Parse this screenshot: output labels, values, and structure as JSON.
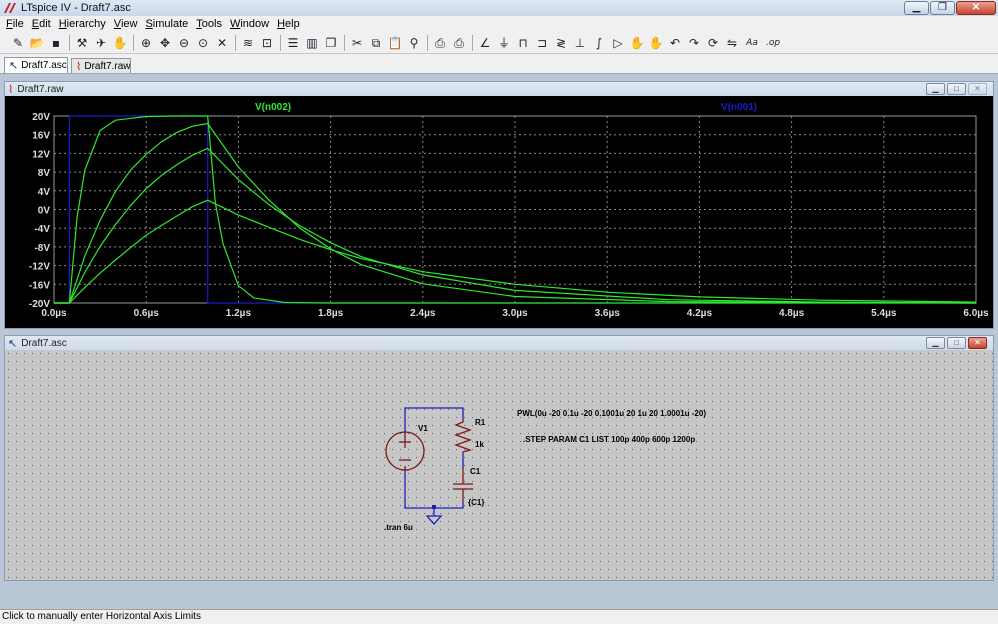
{
  "window": {
    "title": "LTspice IV - Draft7.asc"
  },
  "menu": {
    "items": [
      {
        "key": "F",
        "rest": "ile"
      },
      {
        "key": "E",
        "rest": "dit"
      },
      {
        "key": "H",
        "rest": "ierarchy"
      },
      {
        "key": "V",
        "rest": "iew"
      },
      {
        "key": "S",
        "rest": "imulate"
      },
      {
        "key": "T",
        "rest": "ools"
      },
      {
        "key": "W",
        "rest": "indow"
      },
      {
        "key": "H",
        "rest": "elp"
      }
    ]
  },
  "toolbar": {
    "icons": [
      "new-schematic",
      "open-folder",
      "save",
      "|",
      "control-panel",
      "run",
      "halt",
      "|",
      "zoom-in",
      "pan",
      "zoom-out",
      "zoom-fit",
      "zoom-cancel",
      "|",
      "autorange",
      "measure",
      "|",
      "tile-horizontal",
      "tile-vertical",
      "cascade",
      "|",
      "cut",
      "copy",
      "paste",
      "find",
      "|",
      "print-preview",
      "print",
      "|",
      "wire",
      "ground",
      "label-net",
      "component",
      "resistor",
      "capacitor",
      "inductor",
      "diode",
      "move",
      "drag",
      "undo",
      "redo",
      "rotate",
      "mirror",
      "text",
      "spice-directive"
    ]
  },
  "tabs": [
    {
      "label": "Draft7.asc",
      "icon": "schematic-icon"
    },
    {
      "label": "Draft7.raw",
      "icon": "waveform-icon"
    }
  ],
  "waveform_window": {
    "title": "Draft7.raw",
    "trace_labels": [
      "V(n002)",
      "V(n001)"
    ],
    "trace_colors": {
      "V(n002)": "#2ee82e",
      "V(n001)": "#1a1acc"
    },
    "background": "#000000",
    "grid_color": "#8a8a8a"
  },
  "schematic_window": {
    "title": "Draft7.asc",
    "components": {
      "v1": {
        "ref": "V1"
      },
      "r1": {
        "ref": "R1",
        "value": "1k"
      },
      "c1": {
        "ref": "C1",
        "value": "{C1}"
      }
    },
    "directives": {
      "pwl": "PWL(0u -20 0.1u -20 0.1001u 20 1u 20 1.0001u -20)",
      "step": ".STEP PARAM C1 LIST 100p  400p 600p 1200p",
      "tran": ".tran 6u"
    },
    "wire_color": "#1d1dbb",
    "component_color": "#7a1a1a",
    "dot_color": "#5a5a5a"
  },
  "chart_data": {
    "type": "line",
    "xlabel": "",
    "ylabel": "",
    "xlim": [
      0,
      6.0
    ],
    "ylim": [
      -20,
      20
    ],
    "x_unit": "µs",
    "y_unit": "V",
    "xticks": [
      "0.0µs",
      "0.6µs",
      "1.2µs",
      "1.8µs",
      "2.4µs",
      "3.0µs",
      "3.6µs",
      "4.2µs",
      "4.8µs",
      "5.4µs",
      "6.0µs"
    ],
    "yticks": [
      "20V",
      "16V",
      "12V",
      "8V",
      "4V",
      "0V",
      "-4V",
      "-8V",
      "-12V",
      "-16V",
      "-20V"
    ],
    "grid": true,
    "series": [
      {
        "name": "V(n001)",
        "color": "#1a1acc",
        "x": [
          0.0,
          0.1,
          0.1001,
          1.0,
          1.0001,
          6.0
        ],
        "y": [
          -20,
          -20,
          20,
          20,
          -20,
          -20
        ]
      },
      {
        "name": "V(n002)",
        "step_param": "C1=100p",
        "color": "#2ee82e",
        "x": [
          0.0,
          0.1,
          0.15,
          0.2,
          0.3,
          0.4,
          0.6,
          0.8,
          1.0,
          1.05,
          1.1,
          1.2,
          1.3,
          1.5,
          1.8,
          6.0
        ],
        "y": [
          -20,
          -20,
          -1.8,
          8.3,
          16.9,
          19.1,
          19.9,
          20.0,
          20.0,
          1.3,
          -7.3,
          -16.3,
          -18.9,
          -19.9,
          -20.0,
          -20.0
        ]
      },
      {
        "name": "V(n002)",
        "step_param": "C1=400p",
        "color": "#2ee82e",
        "x": [
          0.0,
          0.1,
          0.2,
          0.3,
          0.4,
          0.5,
          0.6,
          0.7,
          0.8,
          0.9,
          1.0,
          1.2,
          1.4,
          1.6,
          1.8,
          2.0,
          2.4,
          3.0,
          4.0,
          5.0,
          6.0
        ],
        "y": [
          -20,
          -20,
          -10.0,
          -2.3,
          3.9,
          8.5,
          11.8,
          14.5,
          16.5,
          17.8,
          18.4,
          9.1,
          2.0,
          -4.0,
          -8.4,
          -11.8,
          -15.9,
          -18.6,
          -19.7,
          -19.9,
          -20.0
        ]
      },
      {
        "name": "V(n002)",
        "step_param": "C1=600p",
        "color": "#2ee82e",
        "x": [
          0.0,
          0.1,
          0.2,
          0.3,
          0.4,
          0.5,
          0.6,
          0.7,
          0.8,
          0.9,
          1.0,
          1.2,
          1.4,
          1.6,
          1.8,
          2.0,
          2.4,
          3.0,
          4.0,
          5.0,
          6.0
        ],
        "y": [
          -20,
          -20,
          -13.5,
          -7.9,
          -3.2,
          0.9,
          4.5,
          7.3,
          9.6,
          11.6,
          13.1,
          6.4,
          1.0,
          -3.5,
          -7.1,
          -10.1,
          -14.0,
          -17.3,
          -19.3,
          -19.8,
          -20.0
        ]
      },
      {
        "name": "V(n002)",
        "step_param": "C1=1200p",
        "color": "#2ee82e",
        "x": [
          0.0,
          0.1,
          0.2,
          0.3,
          0.4,
          0.5,
          0.6,
          0.7,
          0.8,
          0.9,
          1.0,
          1.2,
          1.4,
          1.6,
          1.8,
          2.0,
          2.4,
          3.0,
          3.6,
          4.2,
          5.0,
          6.0
        ],
        "y": [
          -20,
          -20,
          -16.7,
          -13.6,
          -10.8,
          -8.1,
          -5.5,
          -3.4,
          -1.4,
          0.6,
          2.0,
          -1.2,
          -3.8,
          -6.4,
          -8.6,
          -10.5,
          -13.3,
          -16.0,
          -17.7,
          -18.7,
          -19.4,
          -19.8
        ]
      }
    ]
  },
  "status": {
    "text": "Click to manually enter Horizontal Axis Limits"
  }
}
